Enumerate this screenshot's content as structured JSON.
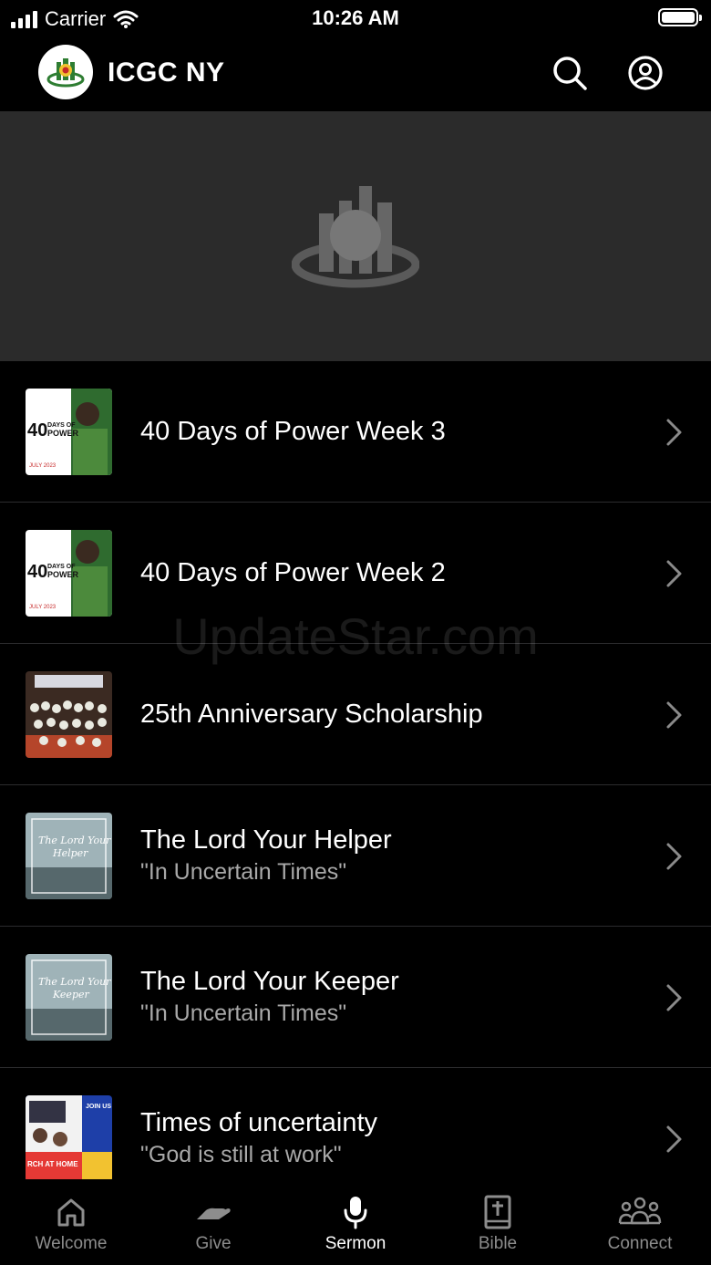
{
  "status_bar": {
    "carrier": "Carrier",
    "time": "10:26 AM"
  },
  "header": {
    "title": "ICGC NY",
    "search_icon": "search-icon",
    "profile_icon": "user-circle-icon"
  },
  "sermons": [
    {
      "title": "40 Days of Power Week 3",
      "subtitle": ""
    },
    {
      "title": "40 Days of Power Week 2",
      "subtitle": ""
    },
    {
      "title": "25th Anniversary Scholarship",
      "subtitle": ""
    },
    {
      "title": "The Lord Your Helper",
      "subtitle": "\"In Uncertain Times\""
    },
    {
      "title": "The Lord Your Keeper",
      "subtitle": "\"In Uncertain Times\""
    },
    {
      "title": "Times of uncertainty",
      "subtitle": "\"God is still at work\""
    }
  ],
  "tabs": [
    {
      "label": "Welcome",
      "icon": "home-icon",
      "active": false
    },
    {
      "label": "Give",
      "icon": "give-hand-icon",
      "active": false
    },
    {
      "label": "Sermon",
      "icon": "microphone-icon",
      "active": true
    },
    {
      "label": "Bible",
      "icon": "bible-icon",
      "active": false
    },
    {
      "label": "Connect",
      "icon": "people-group-icon",
      "active": false
    }
  ],
  "watermark": "UpdateStar.com",
  "colors": {
    "background": "#000000",
    "hero": "#2b2b2b",
    "inactive_tab": "#8d8d8d"
  }
}
